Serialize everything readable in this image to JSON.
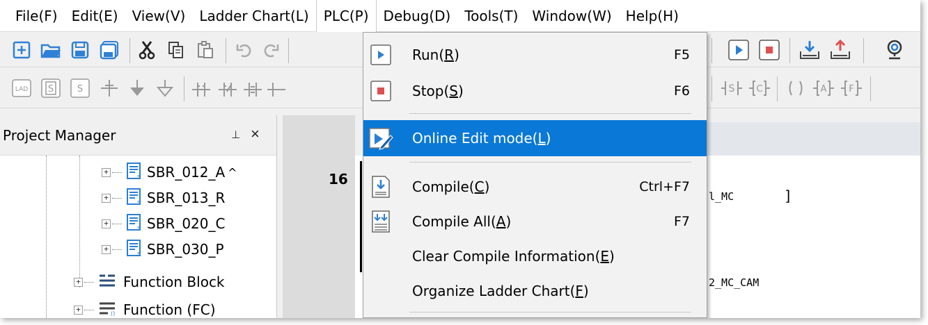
{
  "menubar": {
    "items": [
      "File(F)",
      "Edit(E)",
      "View(V)",
      "Ladder Chart(L)",
      "PLC(P)",
      "Debug(D)",
      "Tools(T)",
      "Window(W)",
      "Help(H)"
    ]
  },
  "project_manager": {
    "title": "Project Manager",
    "pin_glyph": "⊥",
    "close_glyph": "×",
    "tree": [
      {
        "label": "SBR_012_A",
        "icon": "subroutine-icon"
      },
      {
        "label": "SBR_013_R",
        "icon": "subroutine-icon"
      },
      {
        "label": "SBR_020_C",
        "icon": "subroutine-icon"
      },
      {
        "label": "SBR_030_P",
        "icon": "subroutine-icon"
      },
      {
        "label": "Function Block",
        "icon": "function-block-icon"
      },
      {
        "label": "Function (FC)",
        "icon": "function-icon"
      }
    ]
  },
  "editor": {
    "rung_number": "16",
    "fragment_1": "l_MC",
    "bracket": "]",
    "fragment_2": "2_MC_CAM"
  },
  "plc_menu": {
    "items": [
      {
        "label_pre": "Run(",
        "mnemonic": "R",
        "label_post": ")",
        "shortcut": "F5",
        "icon": "run-icon"
      },
      {
        "label_pre": "Stop(",
        "mnemonic": "S",
        "label_post": ")",
        "shortcut": "F6",
        "icon": "stop-icon"
      },
      {
        "label_pre": "Online Edit mode(",
        "mnemonic": "L",
        "label_post": ")",
        "shortcut": "",
        "icon": "online-edit-icon"
      },
      {
        "label_pre": "Compile(",
        "mnemonic": "C",
        "label_post": ")",
        "shortcut": "Ctrl+F7",
        "icon": "compile-icon"
      },
      {
        "label_pre": "Compile All(",
        "mnemonic": "A",
        "label_post": ")",
        "shortcut": "F7",
        "icon": "compile-all-icon"
      },
      {
        "label_pre": "Clear Compile Information(",
        "mnemonic": "E",
        "label_post": ")",
        "shortcut": "",
        "icon": ""
      },
      {
        "label_pre": "Organize Ladder Chart(",
        "mnemonic": "F",
        "label_post": ")",
        "shortcut": "",
        "icon": ""
      }
    ]
  },
  "colors": {
    "highlight": "#0a78d7",
    "toolbar_blue": "#2f80d6",
    "stop_red": "#e05050",
    "run_blue": "#2a7fd4"
  }
}
